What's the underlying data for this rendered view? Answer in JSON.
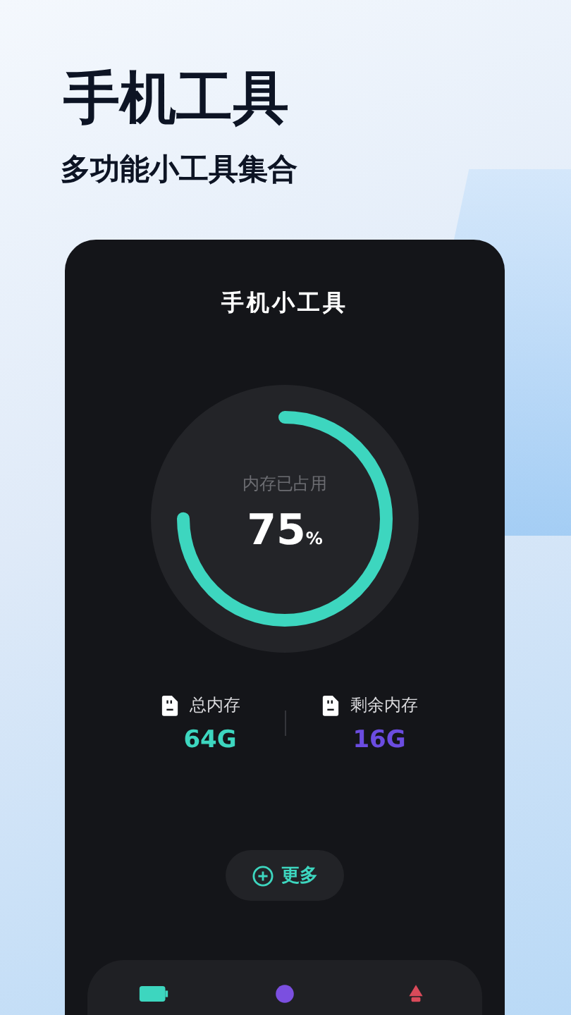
{
  "headline": "手机工具",
  "subtitle": "多功能小工具集合",
  "app": {
    "title": "手机小工具",
    "memory": {
      "label": "内存已占用",
      "value": "75",
      "unit": "%",
      "level": 0.75
    },
    "stats": [
      {
        "label": "总内存",
        "value": "64G",
        "color": "#3dd6bf"
      },
      {
        "label": "剩余内存",
        "value": "16G",
        "color": "#6b4ce0"
      }
    ],
    "more_button": "更多",
    "dock": [
      {
        "kind": "battery"
      },
      {
        "kind": "purple"
      },
      {
        "kind": "red"
      }
    ]
  }
}
